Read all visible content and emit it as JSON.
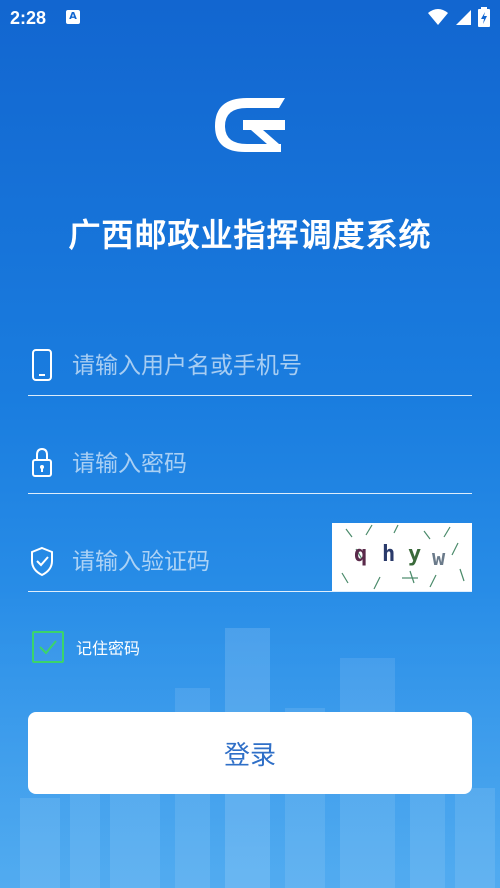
{
  "status_bar": {
    "time": "2:28",
    "notification_glyph": "A"
  },
  "app": {
    "title": "广西邮政业指挥调度系统"
  },
  "form": {
    "username": {
      "placeholder": "请输入用户名或手机号",
      "value": ""
    },
    "password": {
      "placeholder": "请输入密码",
      "value": ""
    },
    "captcha": {
      "placeholder": "请输入验证码",
      "value": "",
      "image_text": [
        "q",
        "h",
        "y",
        "w"
      ]
    },
    "remember": {
      "label": "记住密码",
      "checked": true
    },
    "login_label": "登录"
  },
  "colors": {
    "background": "#1266d0",
    "checkbox": "#3bd46a",
    "button_text": "#2f6fc7"
  }
}
